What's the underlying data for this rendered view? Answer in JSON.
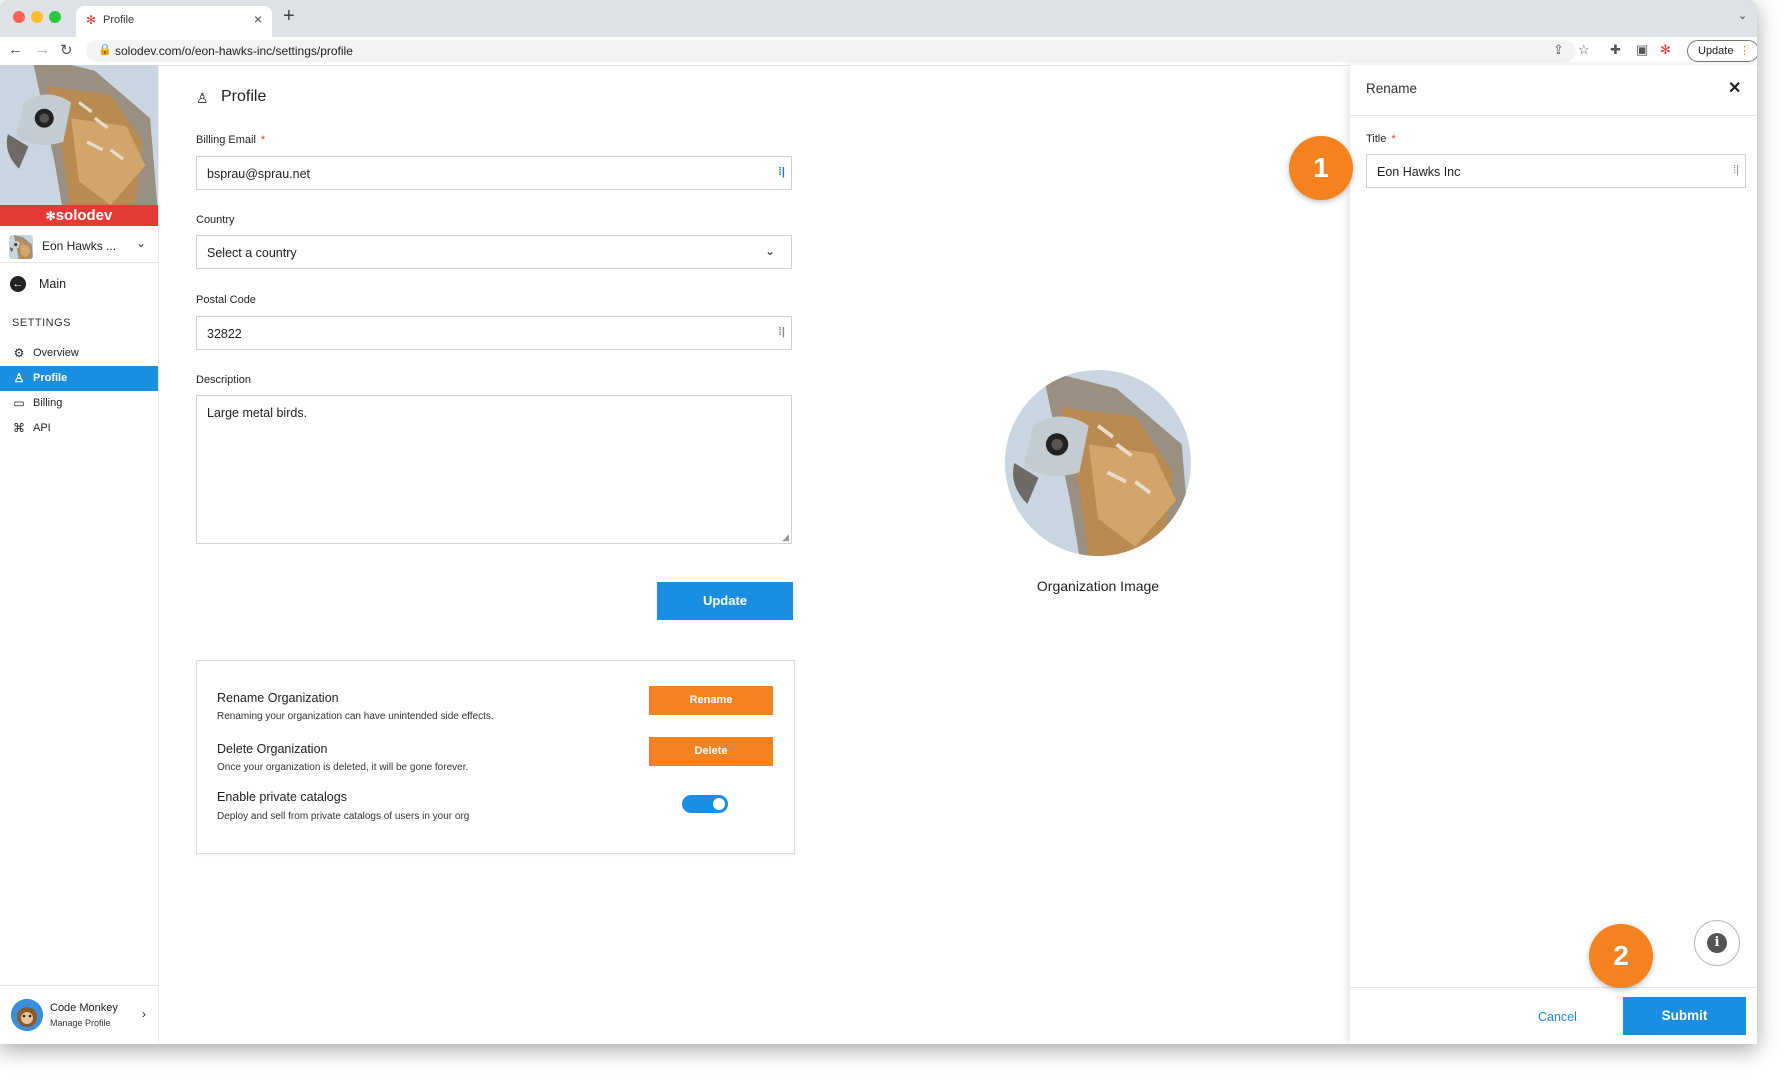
{
  "browser": {
    "tab_title": "Profile",
    "url": "solodev.com/o/eon-hawks-inc/settings/profile",
    "update_label": "Update"
  },
  "sidebar": {
    "brand": "solodev",
    "org_name": "Eon Hawks ...",
    "main_label": "Main",
    "settings_header": "SETTINGS",
    "items": [
      {
        "label": "Overview",
        "icon": "gear-icon",
        "active": false
      },
      {
        "label": "Profile",
        "icon": "user-icon",
        "active": true
      },
      {
        "label": "Billing",
        "icon": "card-icon",
        "active": false
      },
      {
        "label": "API",
        "icon": "api-icon",
        "active": false
      }
    ],
    "user": {
      "name": "Code Monkey",
      "subtitle": "Manage Profile"
    }
  },
  "main": {
    "title": "Profile",
    "billing_email": {
      "label": "Billing Email",
      "value": "bsprau@sprau.net",
      "required": true
    },
    "country": {
      "label": "Country",
      "value": "Select a country"
    },
    "postal_code": {
      "label": "Postal Code",
      "value": "32822"
    },
    "description": {
      "label": "Description",
      "value": "Large metal birds."
    },
    "update_label": "Update",
    "rename_org": {
      "title": "Rename Organization",
      "subtitle": "Renaming your organization can have unintended side effects.",
      "button": "Rename"
    },
    "delete_org": {
      "title": "Delete Organization",
      "subtitle": "Once your organization is deleted, it will be gone forever.",
      "button": "Delete"
    },
    "private_catalogs": {
      "title": "Enable private catalogs",
      "subtitle": "Deploy and sell from private catalogs of users in your org",
      "enabled": true
    },
    "org_image_label": "Organization Image"
  },
  "rename_panel": {
    "title": "Rename",
    "field_label": "Title",
    "field_value": "Eon Hawks Inc",
    "cancel_label": "Cancel",
    "submit_label": "Submit"
  },
  "callouts": [
    "1",
    "2"
  ],
  "colors": {
    "accent": "#1a8ee0",
    "orange": "#f5821f",
    "brand_red": "#e53935"
  }
}
